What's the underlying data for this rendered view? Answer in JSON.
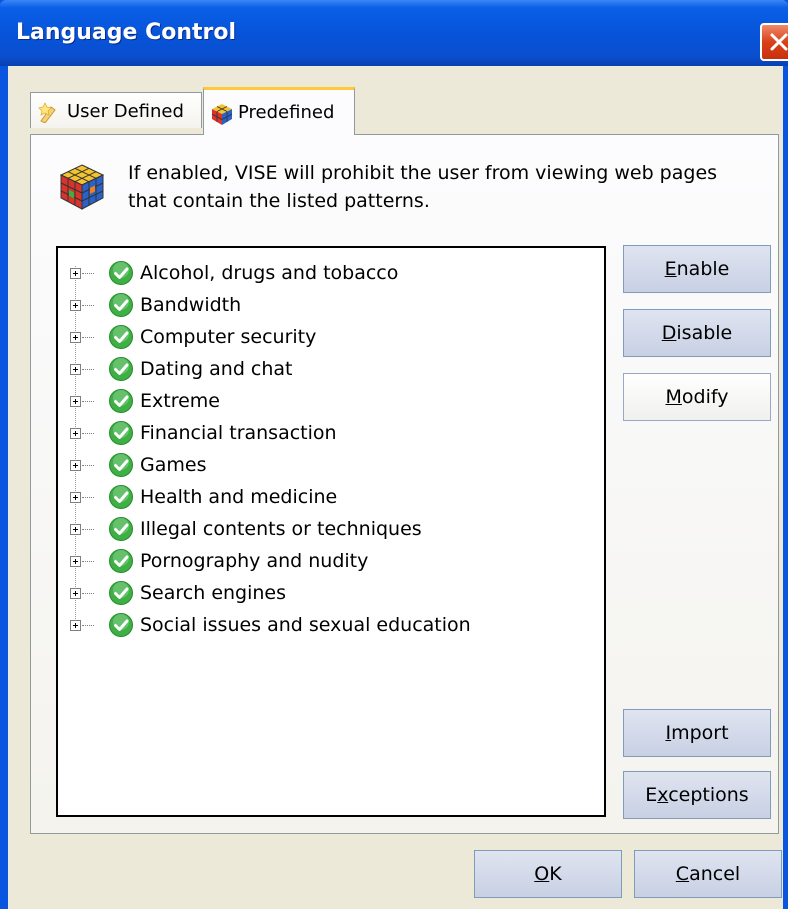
{
  "window": {
    "title": "Language Control"
  },
  "tabs": [
    {
      "label": "User Defined",
      "icon": "pencil-star-icon"
    },
    {
      "label": "Predefined",
      "icon": "cube-icon",
      "selected": true
    }
  ],
  "info": {
    "text": "If enabled, VISE will prohibit the user from viewing web pages that contain the listed patterns."
  },
  "tree": {
    "items": [
      "Alcohol, drugs and tobacco",
      "Bandwidth",
      "Computer security",
      "Dating and chat",
      "Extreme",
      "Financial transaction",
      "Games",
      "Health and medicine",
      "Illegal contents or techniques",
      "Pornography and nudity",
      "Search engines",
      "Social issues and sexual education"
    ],
    "status_icon": "green-check-icon"
  },
  "side_buttons": {
    "enable": {
      "mnemonic": "E",
      "rest": "nable"
    },
    "disable": {
      "mnemonic": "D",
      "rest": "isable"
    },
    "modify": {
      "mnemonic": "M",
      "rest": "odify"
    },
    "import": {
      "mnemonic": "I",
      "rest": "mport"
    },
    "exceptions": {
      "pre": "E",
      "mnemonic": "x",
      "rest": "ceptions"
    }
  },
  "dialog_buttons": {
    "ok": {
      "mnemonic": "O",
      "rest": "K"
    },
    "cancel": {
      "mnemonic": "C",
      "rest": "ancel"
    }
  },
  "colors": {
    "titlebar": "#0753d8",
    "window_bg": "#ece9d8",
    "selected_tab_accent": "#ffc83c",
    "check_green": "#3cb043"
  }
}
